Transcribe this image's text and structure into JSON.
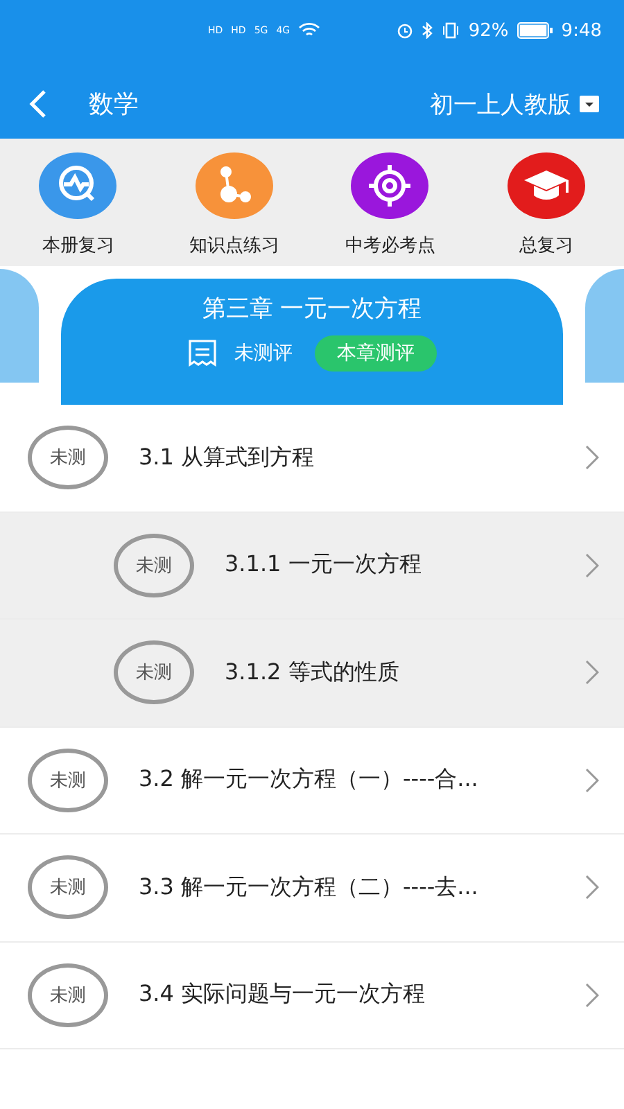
{
  "status_bar": {
    "network_labels": [
      "HD",
      "HD",
      "5G",
      "4G"
    ],
    "battery": "92%",
    "time": "9:48"
  },
  "header": {
    "title": "数学",
    "edition": "初一上人教版"
  },
  "shortcuts": [
    {
      "label": "本册复习",
      "kind": "review",
      "color": "#3a97ea"
    },
    {
      "label": "知识点练习",
      "kind": "nodes",
      "color": "#f7923a"
    },
    {
      "label": "中考必考点",
      "kind": "target",
      "color": "#9a17dc"
    },
    {
      "label": "总复习",
      "kind": "cap",
      "color": "#e21c1c"
    }
  ],
  "chapter": {
    "title": "第三章 一元一次方程",
    "status": "未测评",
    "test_button": "本章测评"
  },
  "sections": [
    {
      "badge": "未测",
      "title": "3.1 从算式到方程",
      "children": [
        {
          "badge": "未测",
          "title": "3.1.1 一元一次方程"
        },
        {
          "badge": "未测",
          "title": "3.1.2 等式的性质"
        }
      ]
    },
    {
      "badge": "未测",
      "title": "3.2 解一元一次方程（一）----合..."
    },
    {
      "badge": "未测",
      "title": "3.3 解一元一次方程（二）----去..."
    },
    {
      "badge": "未测",
      "title": "3.4 实际问题与一元一次方程"
    }
  ]
}
